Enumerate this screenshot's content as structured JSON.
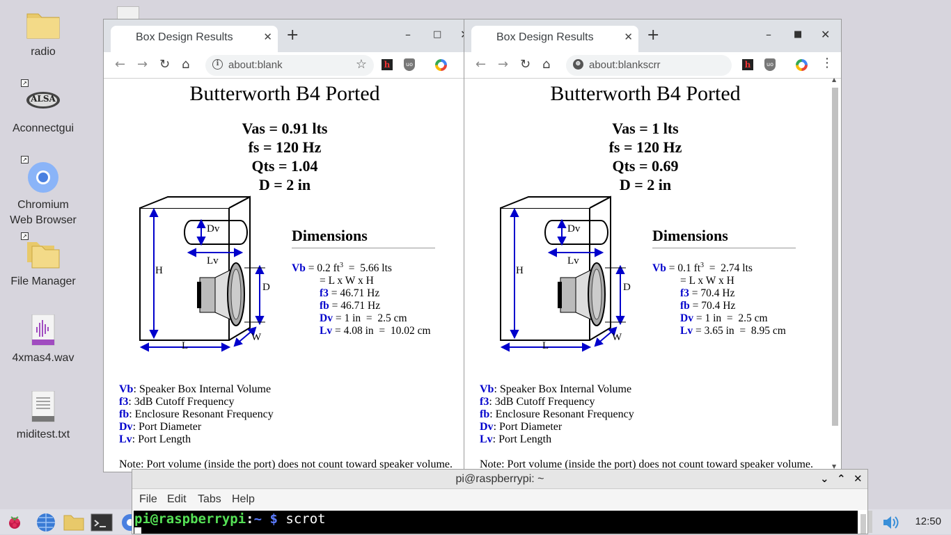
{
  "desktop": {
    "icons": [
      {
        "label": "radio",
        "icon": "folder-icon"
      },
      {
        "label": "Aconnectgui",
        "icon": "alsa-icon",
        "badge": "ALSA"
      },
      {
        "label": "Chromium\nWeb Browser",
        "icon": "chromium-icon"
      },
      {
        "label": "File Manager",
        "icon": "folder-icon"
      },
      {
        "label": "4xmas4.wav",
        "icon": "audio-file-icon"
      },
      {
        "label": "miditest.txt",
        "icon": "text-file-icon"
      }
    ]
  },
  "browser_left": {
    "tab_title": "Box Design Results",
    "url": "about:blank",
    "page": {
      "heading": "Butterworth B4 Ported",
      "vas": "Vas = 0.91 lts",
      "fs": "fs = 120 Hz",
      "qts": "Qts = 1.04",
      "d": "D = 2 in",
      "dims_title": "Dimensions",
      "vb_key": "Vb",
      "vb_value": " = 0.2 ft",
      "vb_exp": "3",
      "vb_rest": "  =  5.66 lts",
      "formula": "= L x W x H",
      "f3_key": "f3",
      "f3_value": " = 46.71 Hz",
      "fb_key": "fb",
      "fb_value": " = 46.71 Hz",
      "dv_key": "Dv",
      "dv_value": " = 1 in  =  2.5 cm",
      "lv_key": "Lv",
      "lv_value": " = 4.08 in  =  10.02 cm"
    }
  },
  "browser_right": {
    "tab_title": "Box Design Results",
    "url": "about:blankscrr",
    "page": {
      "heading": "Butterworth B4 Ported",
      "vas": "Vas = 1 lts",
      "fs": "fs = 120 Hz",
      "qts": "Qts = 0.69",
      "d": "D = 2 in",
      "dims_title": "Dimensions",
      "vb_key": "Vb",
      "vb_value": " = 0.1 ft",
      "vb_exp": "3",
      "vb_rest": "  =  2.74 lts",
      "formula": "= L x W x H",
      "f3_key": "f3",
      "f3_value": " = 70.4 Hz",
      "fb_key": "fb",
      "fb_value": " = 70.4 Hz",
      "dv_key": "Dv",
      "dv_value": " = 1 in  =  2.5 cm",
      "lv_key": "Lv",
      "lv_value": " = 3.65 in  =  8.95 cm"
    }
  },
  "diagram_labels": {
    "dv": "Dv",
    "lv": "Lv",
    "h": "H",
    "d": "D",
    "l": "L",
    "w": "W"
  },
  "glossary": [
    {
      "key": "Vb",
      "text": ": Speaker Box Internal Volume"
    },
    {
      "key": "f3",
      "text": ": 3dB Cutoff Frequency"
    },
    {
      "key": "fb",
      "text": ": Enclosure Resonant Frequency"
    },
    {
      "key": "Dv",
      "text": ": Port Diameter"
    },
    {
      "key": "Lv",
      "text": ": Port Length"
    }
  ],
  "note": "Note: Port volume (inside the port) does not count toward speaker volume.",
  "terminal": {
    "title": "pi@raspberrypi: ~",
    "menu": [
      "File",
      "Edit",
      "Tabs",
      "Help"
    ],
    "prompt_user": "pi@raspberrypi",
    "prompt_sep": ":",
    "prompt_path": "~ $",
    "command": " scrot"
  },
  "taskbar": {
    "clock": "12:50"
  },
  "colors": {
    "accent_blue": "#0000cc",
    "desktop_bg": "#d7d5dd",
    "terminal_green": "#55e055"
  }
}
